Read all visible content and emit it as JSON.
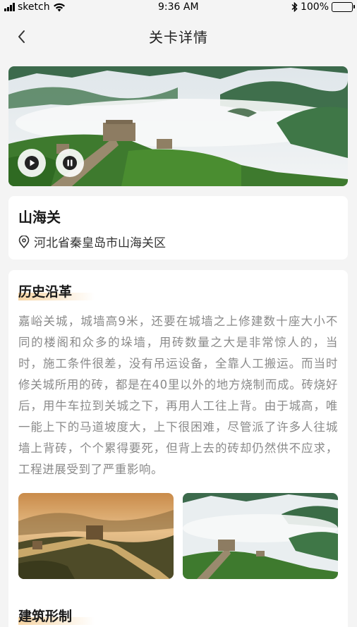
{
  "status_bar": {
    "carrier": "sketch",
    "time": "9:36 AM",
    "battery": "100%"
  },
  "nav": {
    "title": "关卡详情"
  },
  "location": {
    "name": "山海关",
    "address": "河北省秦皇岛市山海关区"
  },
  "history": {
    "title": "历史沿革",
    "text": "嘉峪关城，城墙高9米，还要在城墙之上修建数十座大小不同的楼阁和众多的垛墙，用砖数量之大是非常惊人的，当时，施工条件很差，没有吊运设备，全靠人工搬运。而当时修关城所用的砖，都是在40里以外的地方烧制而成。砖烧好后，用牛车拉到关城之下，再用人工往上背。由于城高，唯一能上下的马道坡度大，上下很困难，尽管派了许多人往城墙上背砖，个个累得要死，但背上去的砖却仍然供不应求，工程进展受到了严重影响。"
  },
  "architecture": {
    "title": "建筑形制"
  },
  "colors": {
    "accent_highlight": "#f6d3a0",
    "body_text": "#8a8a8a"
  },
  "icons": {
    "back": "chevron-left-icon",
    "location": "map-pin-icon",
    "play": "play-icon",
    "pause": "pause-icon",
    "signal": "signal-icon",
    "wifi": "wifi-icon",
    "bluetooth": "bluetooth-icon",
    "battery": "battery-icon"
  }
}
